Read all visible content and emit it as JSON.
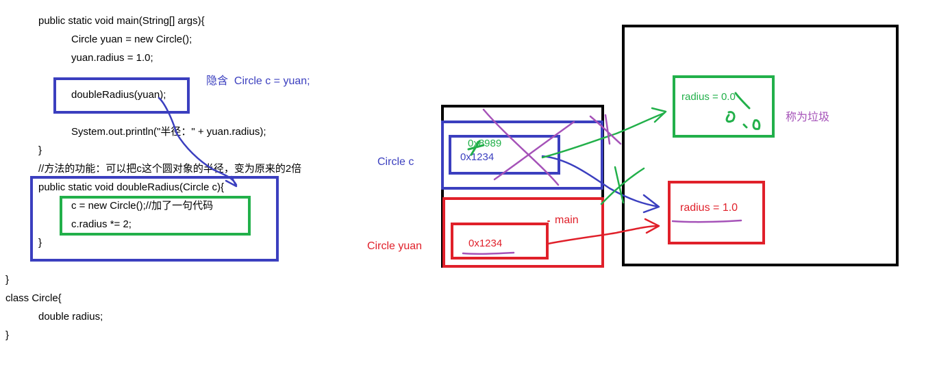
{
  "code": {
    "main_sig": "public static void main(String[] args){",
    "line_new_circle": "Circle yuan = new Circle();",
    "line_set_radius": "yuan.radius = 1.0;",
    "line_call": "doubleRadius(yuan);",
    "line_print": "System.out.println(\"半径：\" + yuan.radius);",
    "brace_close_main": "}",
    "comment": "//方法的功能：可以把c这个圆对象的半径，变为原来的2倍",
    "method_sig": "public static void doubleRadius(Circle c){",
    "line_c_new": "c = new Circle();//加了一句代码",
    "line_c_radius": "c.radius *= 2;",
    "brace_close_method": "}",
    "brace_close_class": "}",
    "class_decl": "class Circle{",
    "field_decl": "double radius;",
    "brace_close_circle": "}"
  },
  "annotations": {
    "implicit_note": "隐含  Circle c = yuan;",
    "garbage_note": "称为垃圾"
  },
  "stack": {
    "label_c": "Circle c",
    "label_yuan": "Circle yuan",
    "frame_main": "main",
    "c_addr_old": "0x1234",
    "c_addr_new": "0x8989",
    "yuan_addr": "0x1234"
  },
  "heap": {
    "new_obj_radius": "radius = 0.0",
    "orig_obj_radius": "radius = 1.0"
  },
  "colors": {
    "blue": "#3b3fbf",
    "green": "#22b04a",
    "red": "#e0202a",
    "purple": "#a552b8",
    "black": "#000000"
  }
}
